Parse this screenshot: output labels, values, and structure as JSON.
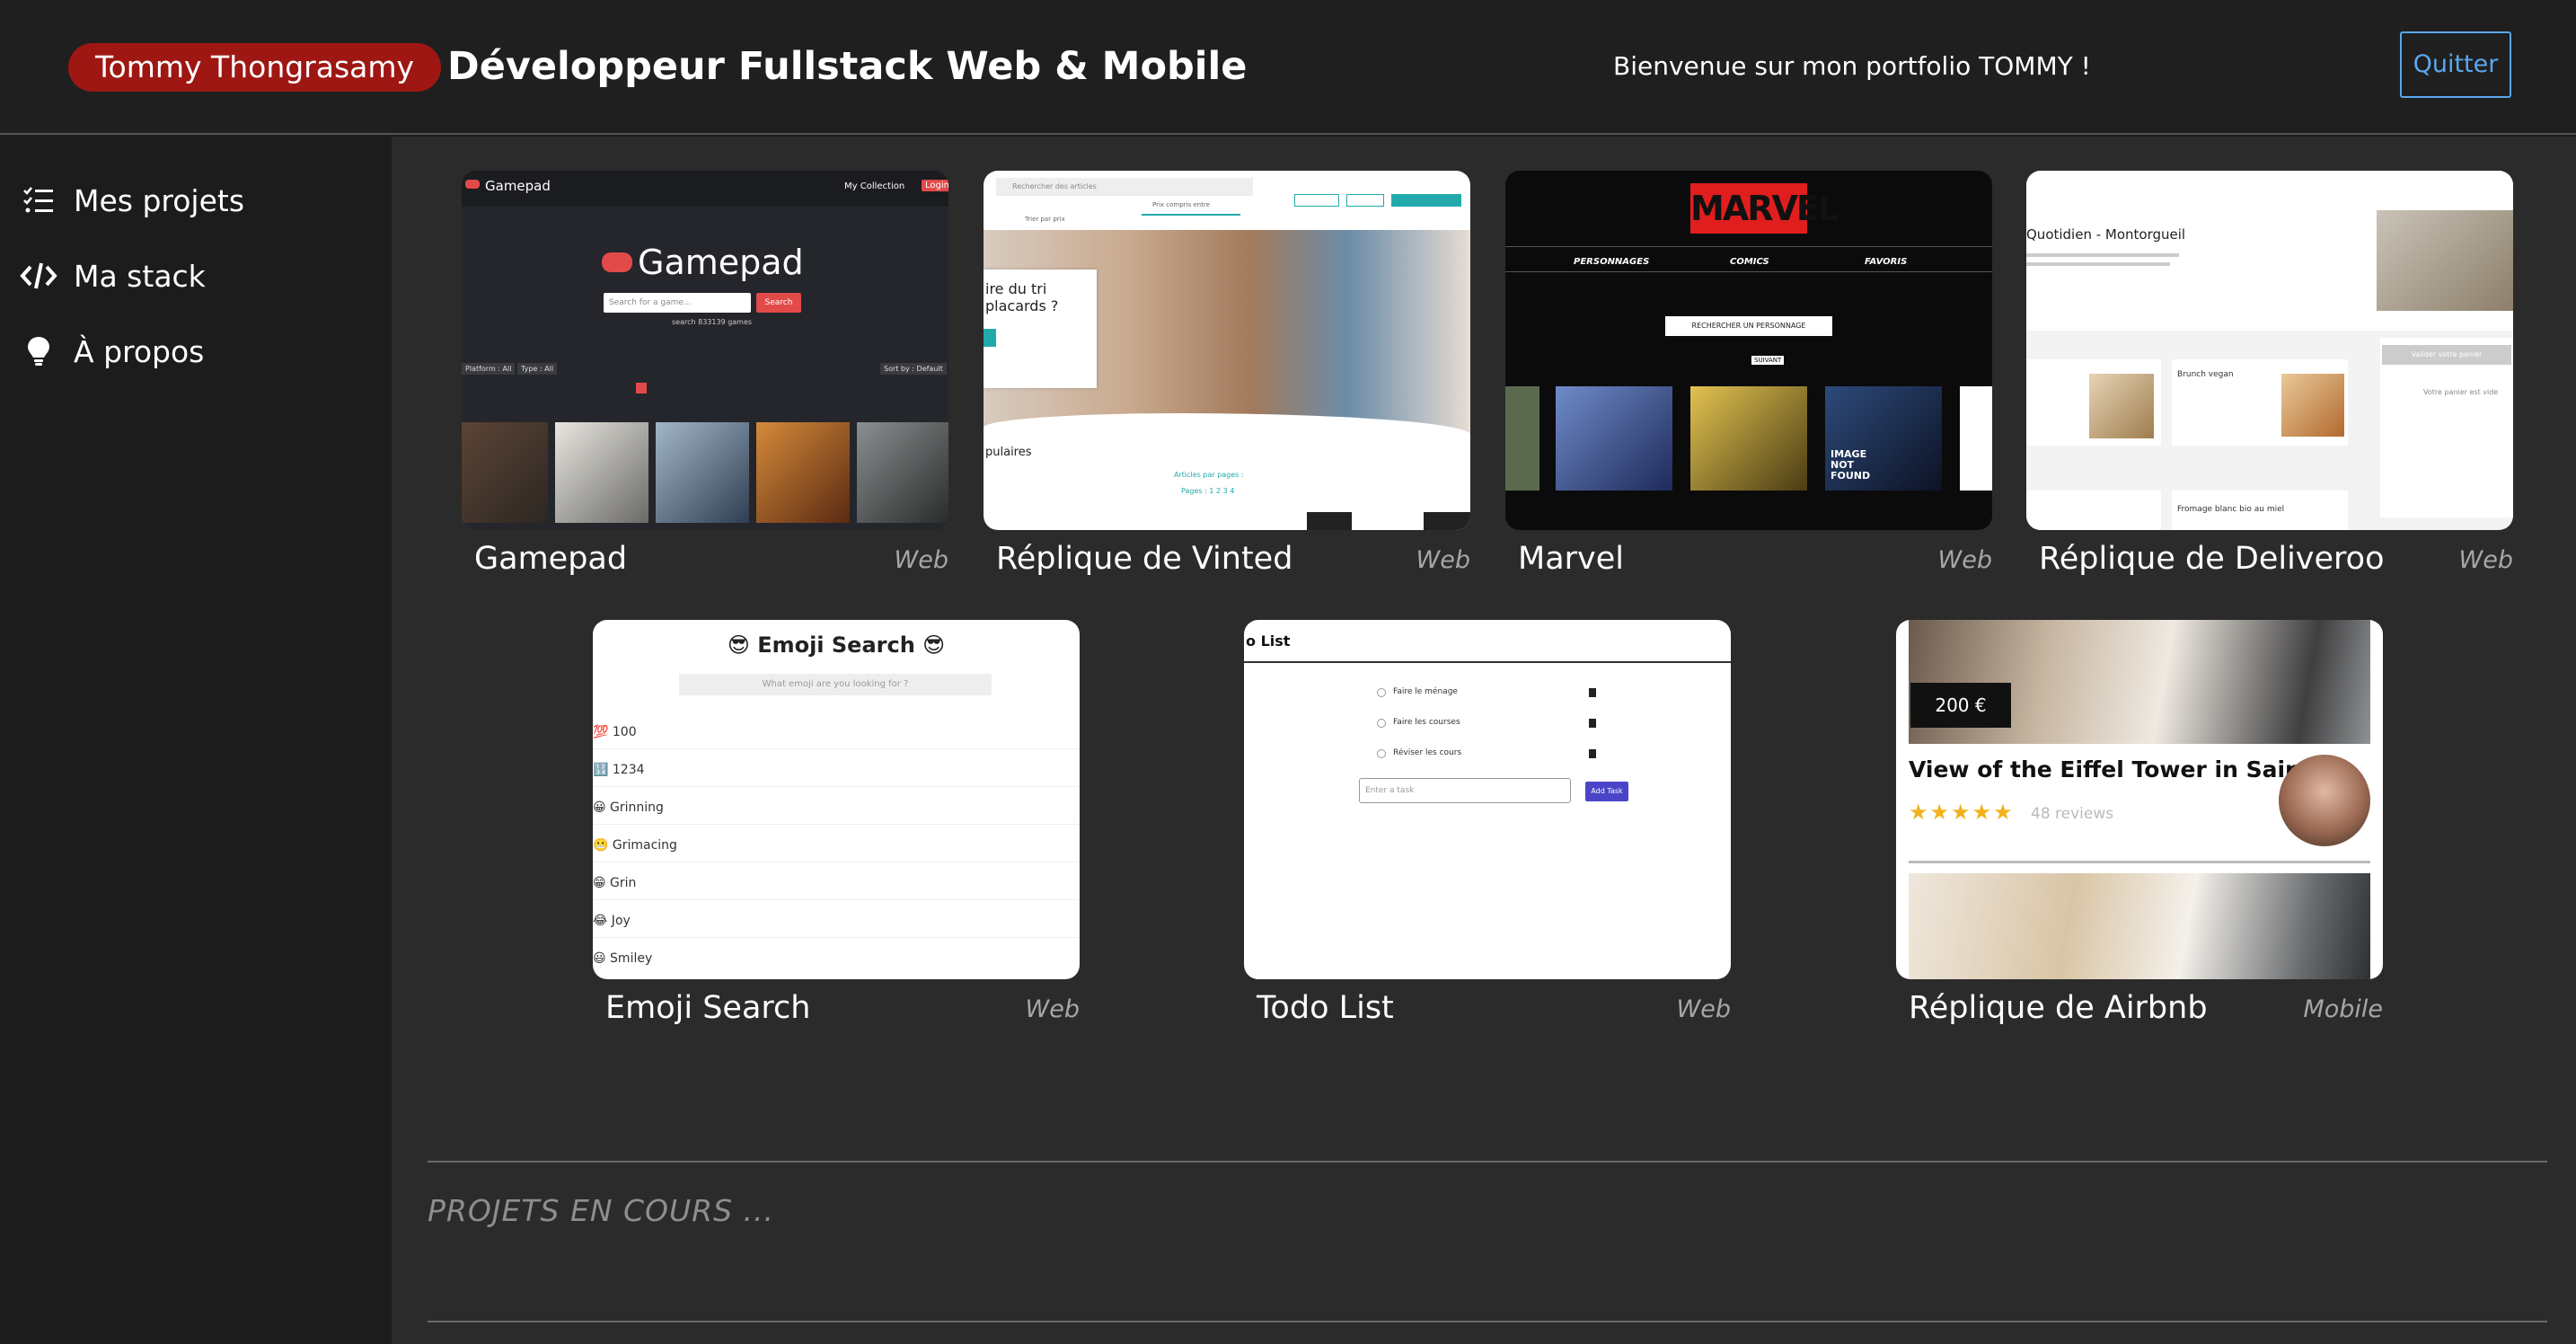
{
  "header": {
    "name": "Tommy Thongrasamy",
    "title": "Développeur Fullstack Web & Mobile",
    "welcome": "Bienvenue sur mon portfolio TOMMY !",
    "quit_label": "Quitter"
  },
  "sidebar": {
    "items": [
      {
        "label": "Mes projets",
        "icon": "list-icon"
      },
      {
        "label": "Ma stack",
        "icon": "code-icon"
      },
      {
        "label": "À propos",
        "icon": "lightbulb-icon"
      }
    ]
  },
  "projects": [
    {
      "title": "Gamepad",
      "type": "Web"
    },
    {
      "title": "Réplique de Vinted",
      "type": "Web"
    },
    {
      "title": "Marvel",
      "type": "Web"
    },
    {
      "title": "Réplique de Deliveroo",
      "type": "Web"
    },
    {
      "title": "Emoji Search",
      "type": "Web"
    },
    {
      "title": "Todo List",
      "type": "Web"
    },
    {
      "title": "Réplique de Airbnb",
      "type": "Mobile"
    }
  ],
  "thumbnails": {
    "gamepad": {
      "brand": "Gamepad",
      "nav_collection": "My Collection",
      "nav_login": "Login",
      "search_placeholder": "Search for a game...",
      "search_button": "Search",
      "search_count": "search 833139 games",
      "filter_platform": "Platform : All",
      "filter_type": "Type : All",
      "sort": "Sort by : Default"
    },
    "vinted": {
      "search_placeholder": "Rechercher des articles",
      "price_sort": "Trier par prix",
      "price_range": "Prix compris entre",
      "hero_text": "ire du tri placards ?",
      "popular": "pulaires",
      "per_page": "Articles par pages :",
      "pages": "Pages : 1 2 3 4"
    },
    "marvel": {
      "logo": "MARVEL",
      "nav": [
        "PERSONNAGES",
        "COMICS",
        "FAVORIS"
      ],
      "search_placeholder": "RECHERCHER UN PERSONNAGE",
      "next": "SUIVANT",
      "not_found": "IMAGE NOT FOUND"
    },
    "deliveroo": {
      "restaurant": "Quotidien - Montorgueil",
      "dish_1": "Brunch vegan",
      "dish_2": "Fromage blanc bio au miel",
      "basket_button": "Valider votre panier",
      "basket_empty": "Votre panier est vide"
    },
    "emoji": {
      "heading": "😎 Emoji Search 😎",
      "search_placeholder": "What emoji are you looking for ?",
      "rows": [
        "💯 100",
        "🔢 1234",
        "😀 Grinning",
        "😬 Grimacing",
        "😁 Grin",
        "😂 Joy",
        "😃 Smiley"
      ]
    },
    "todo": {
      "heading": "o List",
      "tasks": [
        "Faire le ménage",
        "Faire les courses",
        "Réviser les cours"
      ],
      "input_placeholder": "Enter a task",
      "add_button": "Add Task"
    },
    "airbnb": {
      "price": "200 €",
      "listing_title": "View of the Eiffel Tower in Saint...",
      "stars": "★★★★★",
      "reviews": "48 reviews"
    }
  },
  "section_in_progress": "PROJETS EN COURS ...",
  "colors": {
    "badge": "#9e1712",
    "accent_blue": "#5aa7f0",
    "background": "#2b2b2b"
  }
}
